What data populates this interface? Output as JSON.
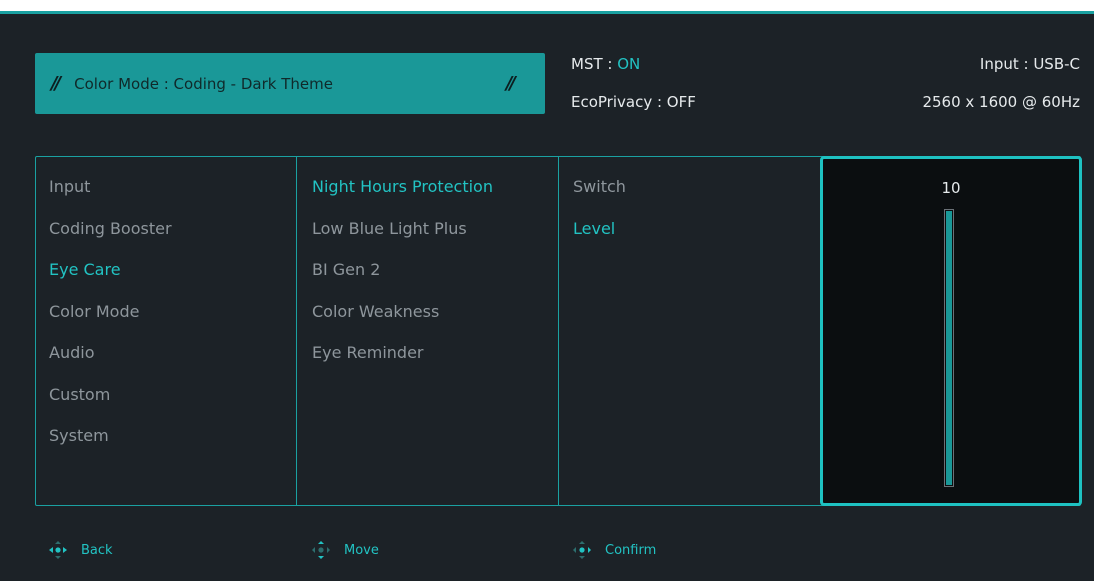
{
  "header": {
    "color_mode_label": "Color Mode : Coding - Dark Theme",
    "slash_glyph": "//",
    "mst_label": "MST : ",
    "mst_value": "ON",
    "eco_privacy": "EcoPrivacy : OFF",
    "input": "Input : USB-C",
    "resolution": "2560 x 1600 @ 60Hz"
  },
  "menu": {
    "main": [
      "Input",
      "Coding Booster",
      "Eye Care",
      "Color Mode",
      "Audio",
      "Custom",
      "System"
    ],
    "main_active": "Eye Care",
    "sub": [
      "Night Hours Protection",
      "Low Blue Light Plus",
      "BI Gen 2",
      "Color Weakness",
      "Eye Reminder"
    ],
    "sub_active": "Night Hours Protection",
    "option": [
      "Switch",
      "Level"
    ],
    "option_active": "Level"
  },
  "level": {
    "value": "10",
    "fraction": 1.0
  },
  "footer": {
    "back": "Back",
    "move": "Move",
    "confirm": "Confirm"
  },
  "colors": {
    "accent": "#1aa1a1",
    "active_text": "#22c3c3",
    "background": "#1c2227",
    "inactive_text": "#8e969c"
  },
  "icons": {
    "back": "joystick-left-icon",
    "move": "joystick-up-down-icon",
    "confirm": "joystick-press-icon"
  }
}
